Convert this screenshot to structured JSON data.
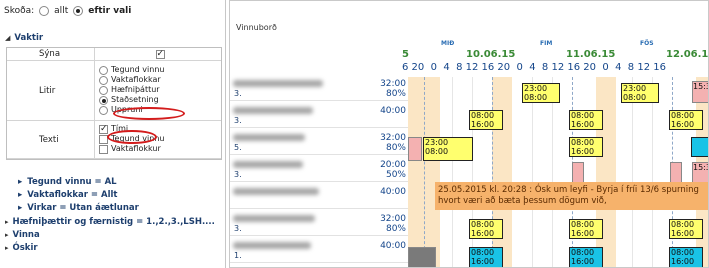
{
  "panel": {
    "show_label": "Skoða:",
    "opt_all": "allt",
    "opt_choice": "eftir vali",
    "section_vaktir": "Vaktir",
    "show_row_label": "Sýna",
    "colors_label": "Litir",
    "color_options": [
      "Tegund vinnu",
      "Vaktaflokkar",
      "Hæfniþáttur",
      "Staðsetning",
      "Uppruni"
    ],
    "text_label": "Texti",
    "text_options": [
      "Tími",
      "Tegund vinnu",
      "Vaktaflokkur"
    ],
    "sub_type": "Tegund vinnu = AL",
    "sub_flokkar": "Vaktaflokkar = Allt",
    "sub_virkar": "Virkar = Utan áætlunar",
    "sec_skills": "Hæfniþættir og færnistig = 1.,2.,3.,LSH....",
    "sec_vinna": "Vinna",
    "sec_oskir": "Óskir"
  },
  "schedule": {
    "title": "Vinnuborð",
    "day_labels": [
      "MIÐ",
      "FIM",
      "FÖS"
    ],
    "dates": [
      "5",
      "10.06.15",
      "11.06.15",
      "12.06.1"
    ],
    "hours_text": "6 20  0  4  8 12 16 20  0  4  8 12 16 20  0  4  8 12 16",
    "rows": [
      {
        "name": "3.",
        "v1": "32:00",
        "v2": "80%"
      },
      {
        "name": "3.",
        "v1": "40:00",
        "v2": ""
      },
      {
        "name": "5.",
        "v1": "32:00",
        "v2": "80%"
      },
      {
        "name": "3.",
        "v1": "20:00",
        "v2": "50%"
      },
      {
        "name": "",
        "v1": "40:00",
        "v2": ""
      },
      {
        "name": "3.",
        "v1": "32:00",
        "v2": "80%"
      },
      {
        "name": "1.",
        "v1": "40:00",
        "v2": ""
      }
    ],
    "shift_time": "23:00\n08:00",
    "shift_time2": "08:00\n16:00",
    "shift_time3": "15:3",
    "note_text": "25.05.2015 kl. 20:28 : Ósk um leyfi - Byrja í fríi 13/6 spurning hvort væri að bæta þessum dögum við,"
  }
}
